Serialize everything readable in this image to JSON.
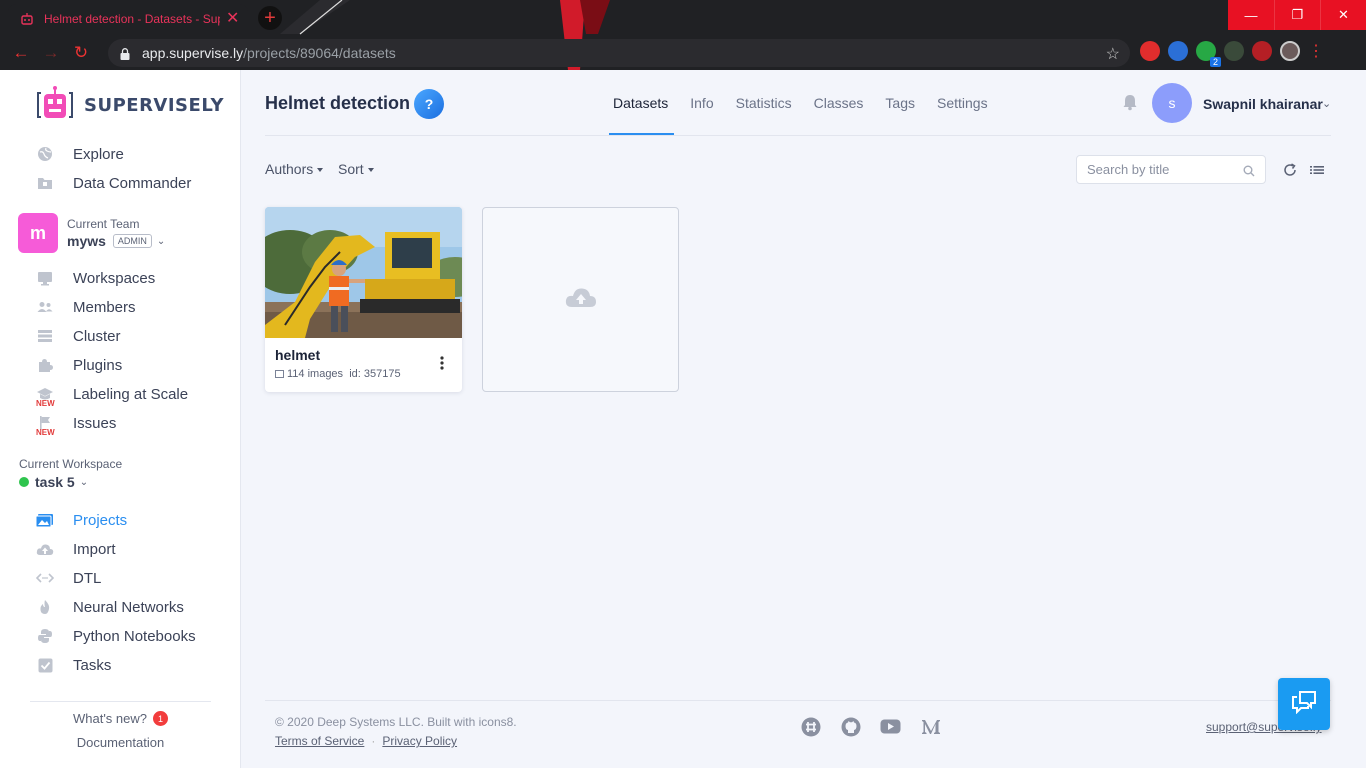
{
  "browser": {
    "tab_title": "Helmet detection - Datasets - Supervisely",
    "url_host": "app.supervise.ly",
    "url_path": "/projects/89064/datasets",
    "extension_badge": "2"
  },
  "sidebar": {
    "brand": "SUPERVISELY",
    "top_items": [
      {
        "label": "Explore",
        "icon": "globe-icon"
      },
      {
        "label": "Data Commander",
        "icon": "folder-icon"
      }
    ],
    "team": {
      "caption": "Current Team",
      "name": "myws",
      "role": "ADMIN",
      "avatar_letter": "m"
    },
    "team_items": [
      {
        "label": "Workspaces",
        "icon": "monitor-icon"
      },
      {
        "label": "Members",
        "icon": "users-icon"
      },
      {
        "label": "Cluster",
        "icon": "server-icon"
      },
      {
        "label": "Plugins",
        "icon": "puzzle-icon"
      },
      {
        "label": "Labeling at Scale",
        "icon": "graduation-icon",
        "tag": "NEW"
      },
      {
        "label": "Issues",
        "icon": "flag-icon",
        "tag": "NEW"
      }
    ],
    "workspace": {
      "caption": "Current Workspace",
      "name": "task 5"
    },
    "workspace_items": [
      {
        "label": "Projects",
        "icon": "images-icon",
        "active": true
      },
      {
        "label": "Import",
        "icon": "cloud-upload-icon"
      },
      {
        "label": "DTL",
        "icon": "code-icon"
      },
      {
        "label": "Neural Networks",
        "icon": "fire-icon"
      },
      {
        "label": "Python Notebooks",
        "icon": "python-icon"
      },
      {
        "label": "Tasks",
        "icon": "checkbox-icon"
      }
    ],
    "whats_new": "What's new?",
    "whats_new_count": "1",
    "documentation": "Documentation"
  },
  "header": {
    "title": "Helmet detection",
    "help": "?",
    "tabs": [
      "Datasets",
      "Info",
      "Statistics",
      "Classes",
      "Tags",
      "Settings"
    ],
    "active_tab": "Datasets",
    "user_initial": "s",
    "user_name": "Swapnil khairanar"
  },
  "toolbar": {
    "authors": "Authors",
    "sort": "Sort",
    "search_placeholder": "Search by title"
  },
  "datasets": [
    {
      "name": "helmet",
      "images": "114 images",
      "id": "id: 357175"
    }
  ],
  "footer": {
    "copyright": "© 2020 Deep Systems LLC. Built with icons8.",
    "terms": "Terms of Service",
    "privacy": "Privacy Policy",
    "support": "support@supervise.ly"
  },
  "colors": {
    "accent": "#2a8ef0",
    "team_avatar": "#f65bd8",
    "user_avatar": "#8c9dfb",
    "chat_button": "#1a9bf2",
    "status_green": "#2fc44e"
  }
}
